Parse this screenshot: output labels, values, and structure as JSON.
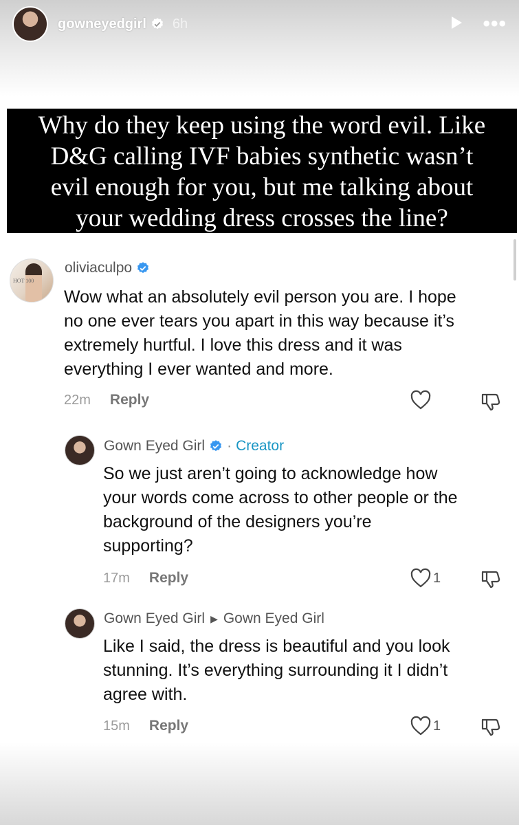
{
  "story": {
    "username": "gowneyedgirl",
    "time": "6h"
  },
  "caption": {
    "lines": [
      "Why do they keep using the word evil. Like",
      "D&G calling IVF babies synthetic wasn’t",
      "evil enough for you, but me talking about",
      "your wedding dress crosses the line?"
    ]
  },
  "comments": [
    {
      "author": "oliviaculpo",
      "lines": [
        "Wow what an absolutely evil person you are. I hope",
        "no one ever tears you apart in this way because it’s",
        "extremely hurtful. I love this dress and it was",
        "everything I ever wanted and more."
      ],
      "time": "22m",
      "reply_label": "Reply",
      "avatar_text": "HOT 100"
    },
    {
      "author": "Gown Eyed Girl",
      "separator": "·",
      "tag": "Creator",
      "lines": [
        "So we just aren’t going to acknowledge how",
        "your words come across to other people or the",
        "background of the designers you’re",
        "supporting?"
      ],
      "time": "17m",
      "reply_label": "Reply",
      "likes": "1"
    },
    {
      "author": "Gown Eyed Girl",
      "reply_to": "Gown Eyed Girl",
      "lines": [
        "Like I said, the dress is beautiful and you look",
        "stunning. It’s everything surrounding it I didn’t",
        "agree with."
      ],
      "time": "15m",
      "reply_label": "Reply",
      "likes": "1"
    }
  ],
  "icons": {
    "verified": "verified-badge-icon",
    "play": "play-icon",
    "more": "more-options-icon",
    "like": "heart-icon",
    "dislike": "thumbs-down-icon",
    "reply_arrow": "reply-arrow-icon"
  },
  "colors": {
    "verified": "#3897f0",
    "creator": "#1a96c4",
    "caption_bg": "#000000"
  }
}
